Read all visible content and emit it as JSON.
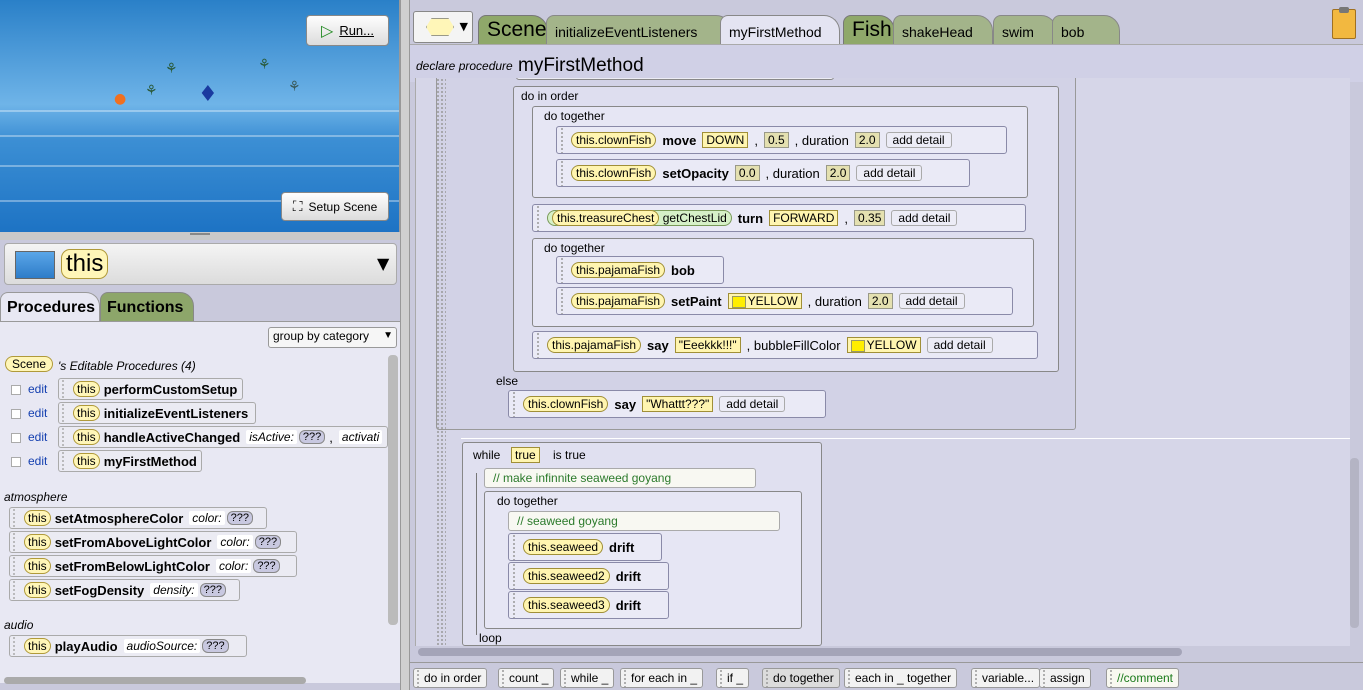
{
  "scene": {
    "run_label": "Run...",
    "setup_label": "Setup Scene"
  },
  "selector": {
    "value": "this"
  },
  "left_tabs": {
    "procedures": "Procedures",
    "functions": "Functions"
  },
  "group_by": {
    "value": "group by category"
  },
  "editable": {
    "scene_tag": "Scene",
    "title": "'s Editable Procedures (4)",
    "edit_label": "edit",
    "this_label": "this",
    "items": [
      {
        "name": "performCustomSetup"
      },
      {
        "name": "initializeEventListeners"
      },
      {
        "name": "handleActiveChanged",
        "param": "isActive:",
        "param_value": "???",
        "extra": "activati"
      },
      {
        "name": "myFirstMethod"
      }
    ]
  },
  "atmosphere": {
    "label": "atmosphere",
    "items": [
      {
        "name": "setAtmosphereColor",
        "param": "color:",
        "value": "???"
      },
      {
        "name": "setFromAboveLightColor",
        "param": "color:",
        "value": "???"
      },
      {
        "name": "setFromBelowLightColor",
        "param": "color:",
        "value": "???"
      },
      {
        "name": "setFogDensity",
        "param": "density:",
        "value": "???"
      }
    ]
  },
  "audio": {
    "label": "audio",
    "items": [
      {
        "name": "playAudio",
        "param": "audioSource:",
        "value": "???"
      }
    ]
  },
  "top_tabs": {
    "scene": "Scene",
    "init": "initializeEventListeners",
    "myfirst": "myFirstMethod",
    "fish": "Fish",
    "shake": "shakeHead",
    "swim": "swim",
    "bob": "bob"
  },
  "header": {
    "declare": "declare procedure",
    "name": "myFirstMethod"
  },
  "code": {
    "do_in_order": "do in order",
    "do_together": "do together",
    "else": "else",
    "add_detail": "add detail",
    "duration": ", duration",
    "s1": {
      "obj": "this.clownFish",
      "meth": "move",
      "a1": "DOWN",
      "a2": "0.5",
      "dur": "2.0"
    },
    "s2": {
      "obj": "this.clownFish",
      "meth": "setOpacity",
      "a1": "0.0",
      "dur": "2.0"
    },
    "s3": {
      "obj": "this.treasureChest",
      "fn": "getChestLid",
      "meth": "turn",
      "a1": "FORWARD",
      "a2": "0.35"
    },
    "s4": {
      "obj": "this.pajamaFish",
      "meth": "bob"
    },
    "s5": {
      "obj": "this.pajamaFish",
      "meth": "setPaint",
      "a1": "YELLOW",
      "dur": "2.0"
    },
    "s6": {
      "obj": "this.pajamaFish",
      "meth": "say",
      "a1": "\"Eeekkk!!!\"",
      "bubble": ", bubbleFillColor",
      "a2": "YELLOW"
    },
    "s7": {
      "obj": "this.clownFish",
      "meth": "say",
      "a1": "\"Whattt???\""
    },
    "while": "while",
    "while_cond": "true",
    "is_true": "is true",
    "comment1": "// make infinnite seaweed goyang",
    "comment2": "// seaweed goyang",
    "drift": "drift",
    "sw1": "this.seaweed",
    "sw2": "this.seaweed2",
    "sw3": "this.seaweed3",
    "loop": "loop"
  },
  "toolbar": {
    "do_in_order": "do in order",
    "count": "count _",
    "while": "while _",
    "for_each": "for each in _",
    "if": "if _",
    "do_together": "do together",
    "each_together": "each in _ together",
    "variable": "variable...",
    "assign": "assign",
    "comment": "//comment"
  }
}
